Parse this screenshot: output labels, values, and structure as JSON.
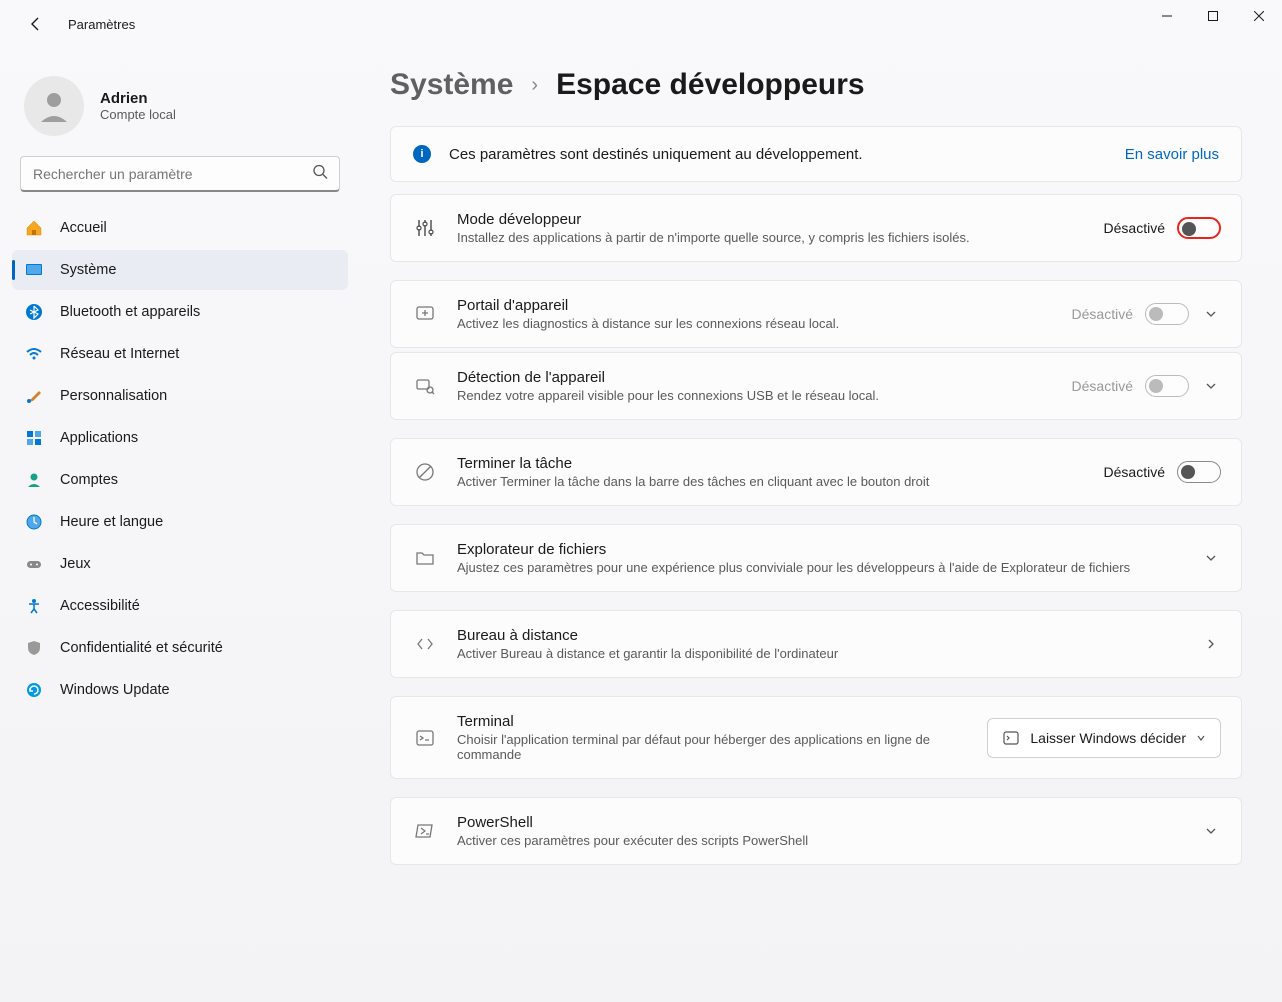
{
  "window": {
    "title": "Paramètres"
  },
  "profile": {
    "name": "Adrien",
    "type": "Compte local"
  },
  "search": {
    "placeholder": "Rechercher un paramètre"
  },
  "nav": {
    "items": [
      {
        "label": "Accueil"
      },
      {
        "label": "Système"
      },
      {
        "label": "Bluetooth et appareils"
      },
      {
        "label": "Réseau et Internet"
      },
      {
        "label": "Personnalisation"
      },
      {
        "label": "Applications"
      },
      {
        "label": "Comptes"
      },
      {
        "label": "Heure et langue"
      },
      {
        "label": "Jeux"
      },
      {
        "label": "Accessibilité"
      },
      {
        "label": "Confidentialité et sécurité"
      },
      {
        "label": "Windows Update"
      }
    ]
  },
  "breadcrumb": {
    "parent": "Système",
    "sep": "›",
    "current": "Espace développeurs"
  },
  "banner": {
    "text": "Ces paramètres sont destinés uniquement au développement.",
    "link": "En savoir plus"
  },
  "cards": {
    "devmode": {
      "title": "Mode développeur",
      "desc": "Installez des applications à partir de n'importe quelle source, y compris les fichiers isolés.",
      "state": "Désactivé"
    },
    "portal": {
      "title": "Portail d'appareil",
      "desc": "Activez les diagnostics à distance sur les connexions réseau local.",
      "state": "Désactivé"
    },
    "detect": {
      "title": "Détection de l'appareil",
      "desc": "Rendez votre appareil visible pour les connexions USB et le réseau local.",
      "state": "Désactivé"
    },
    "endtask": {
      "title": "Terminer la tâche",
      "desc": "Activer Terminer la tâche dans la barre des tâches en cliquant avec le bouton droit",
      "state": "Désactivé"
    },
    "explorer": {
      "title": "Explorateur de fichiers",
      "desc": "Ajustez ces paramètres pour une expérience plus conviviale pour les développeurs à l'aide de Explorateur de fichiers"
    },
    "remote": {
      "title": "Bureau à distance",
      "desc": "Activer Bureau à distance et garantir la disponibilité de l'ordinateur"
    },
    "terminal": {
      "title": "Terminal",
      "desc": "Choisir l'application terminal par défaut pour héberger des applications en ligne de commande",
      "dropdown": "Laisser Windows décider"
    },
    "powershell": {
      "title": "PowerShell",
      "desc": "Activer ces paramètres pour exécuter des scripts PowerShell"
    }
  }
}
